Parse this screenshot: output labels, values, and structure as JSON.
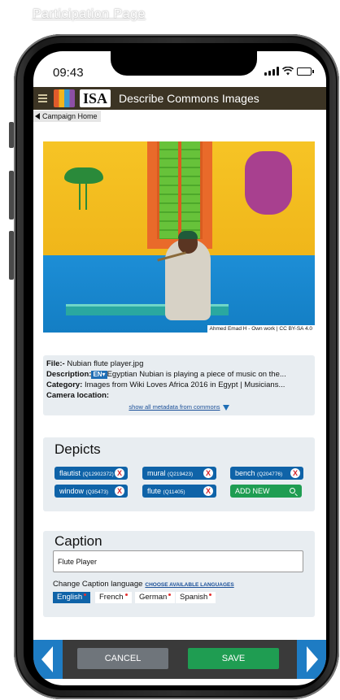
{
  "page_label": "Participation Page",
  "status_bar": {
    "time": "09:43"
  },
  "app_bar": {
    "logo_text": "ISA",
    "title": "Describe Commons Images"
  },
  "breadcrumb": {
    "label": "Campaign Home"
  },
  "photo": {
    "credit": "Ahmed Emad H - Own work | CC BY-SA 4.0"
  },
  "metadata": {
    "file_label": "File:-",
    "file_value": " Nubian flute player.jpg",
    "description_label": "Description:",
    "description_lang": "EN▾",
    "description_value": "Egyptian Nubian is playing a piece of music on the...",
    "category_label": "Category:",
    "category_value": " Images from Wiki Loves Africa 2016 in Egypt | Musicians...",
    "camera_label": "Camera location:",
    "show_all_link": "show all metadata from commons"
  },
  "depicts": {
    "title": "Depicts",
    "tags": [
      {
        "label": "flautist",
        "qid": "(Q12902372)"
      },
      {
        "label": "mural",
        "qid": "(Q219423)"
      },
      {
        "label": "bench",
        "qid": "(Q204776)"
      },
      {
        "label": "window",
        "qid": "(Q35473)"
      },
      {
        "label": "flute",
        "qid": "(Q11405)"
      }
    ],
    "remove_symbol": "X",
    "add_new_label": "ADD NEW"
  },
  "caption": {
    "title": "Caption",
    "value": "Flute Player",
    "change_language_label": "Change Caption language",
    "choose_languages_link": "CHOOSE AVAILABLE LANGUAGES",
    "languages": [
      {
        "label": "English",
        "active": true
      },
      {
        "label": "French",
        "active": false
      },
      {
        "label": "German",
        "active": false
      },
      {
        "label": "Spanish",
        "active": false
      }
    ]
  },
  "actions": {
    "cancel_label": "CANCEL",
    "save_label": "SAVE"
  },
  "colors": {
    "app_bar": "#3c3424",
    "primary_blue": "#0f63a8",
    "save_green": "#1f9d52",
    "card_bg": "#e8edf1"
  }
}
